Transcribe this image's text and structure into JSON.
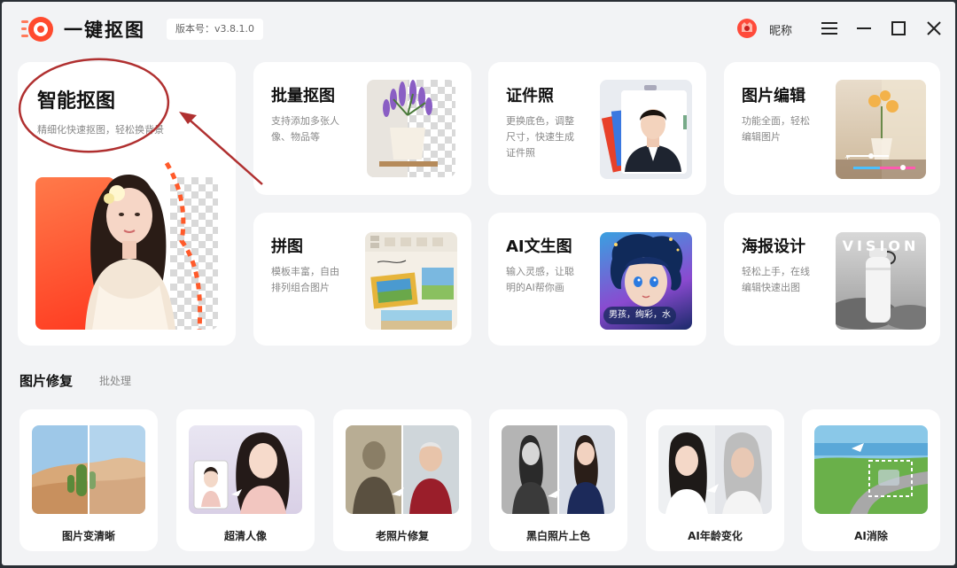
{
  "app": {
    "title": "一键抠图",
    "version": "版本号：v3.8.1.0",
    "nickname": "昵称"
  },
  "window_controls": {
    "menu": "menu-icon",
    "minimize": "minimize-icon",
    "maximize": "maximize-icon",
    "close": "close-icon"
  },
  "hero": {
    "title": "智能抠图",
    "desc": "精细化快速抠图，轻松换背景"
  },
  "features": [
    {
      "title": "批量抠图",
      "desc1": "支持添加多张人",
      "desc2": "像、物品等"
    },
    {
      "title": "证件照",
      "desc1": "更换底色，调整",
      "desc2": "尺寸，快速生成",
      "desc3": "证件照"
    },
    {
      "title": "图片编辑",
      "desc1": "功能全面，轻松",
      "desc2": "编辑图片"
    },
    {
      "title": "拼图",
      "desc1": "模板丰富，自由",
      "desc2": "排列组合图片"
    },
    {
      "title": "AI文生图",
      "desc1": "输入灵感，让聪",
      "desc2": "明的AI帮你画",
      "chip": "男孩，绚彩，水"
    },
    {
      "title": "海报设计",
      "desc1": "轻松上手，在线",
      "desc2": "编辑快速出图",
      "logo_text": "VISION"
    }
  ],
  "repair_section": {
    "title": "图片修复",
    "link": "批处理"
  },
  "repair_tools": [
    {
      "label": "图片变清晰"
    },
    {
      "label": "超清人像"
    },
    {
      "label": "老照片修复"
    },
    {
      "label": "黑白照片上色"
    },
    {
      "label": "AI年龄变化"
    },
    {
      "label": "AI消除"
    }
  ],
  "colors": {
    "accent": "#ff5a3c",
    "annotation": "#b03030",
    "background": "#f2f3f5"
  }
}
